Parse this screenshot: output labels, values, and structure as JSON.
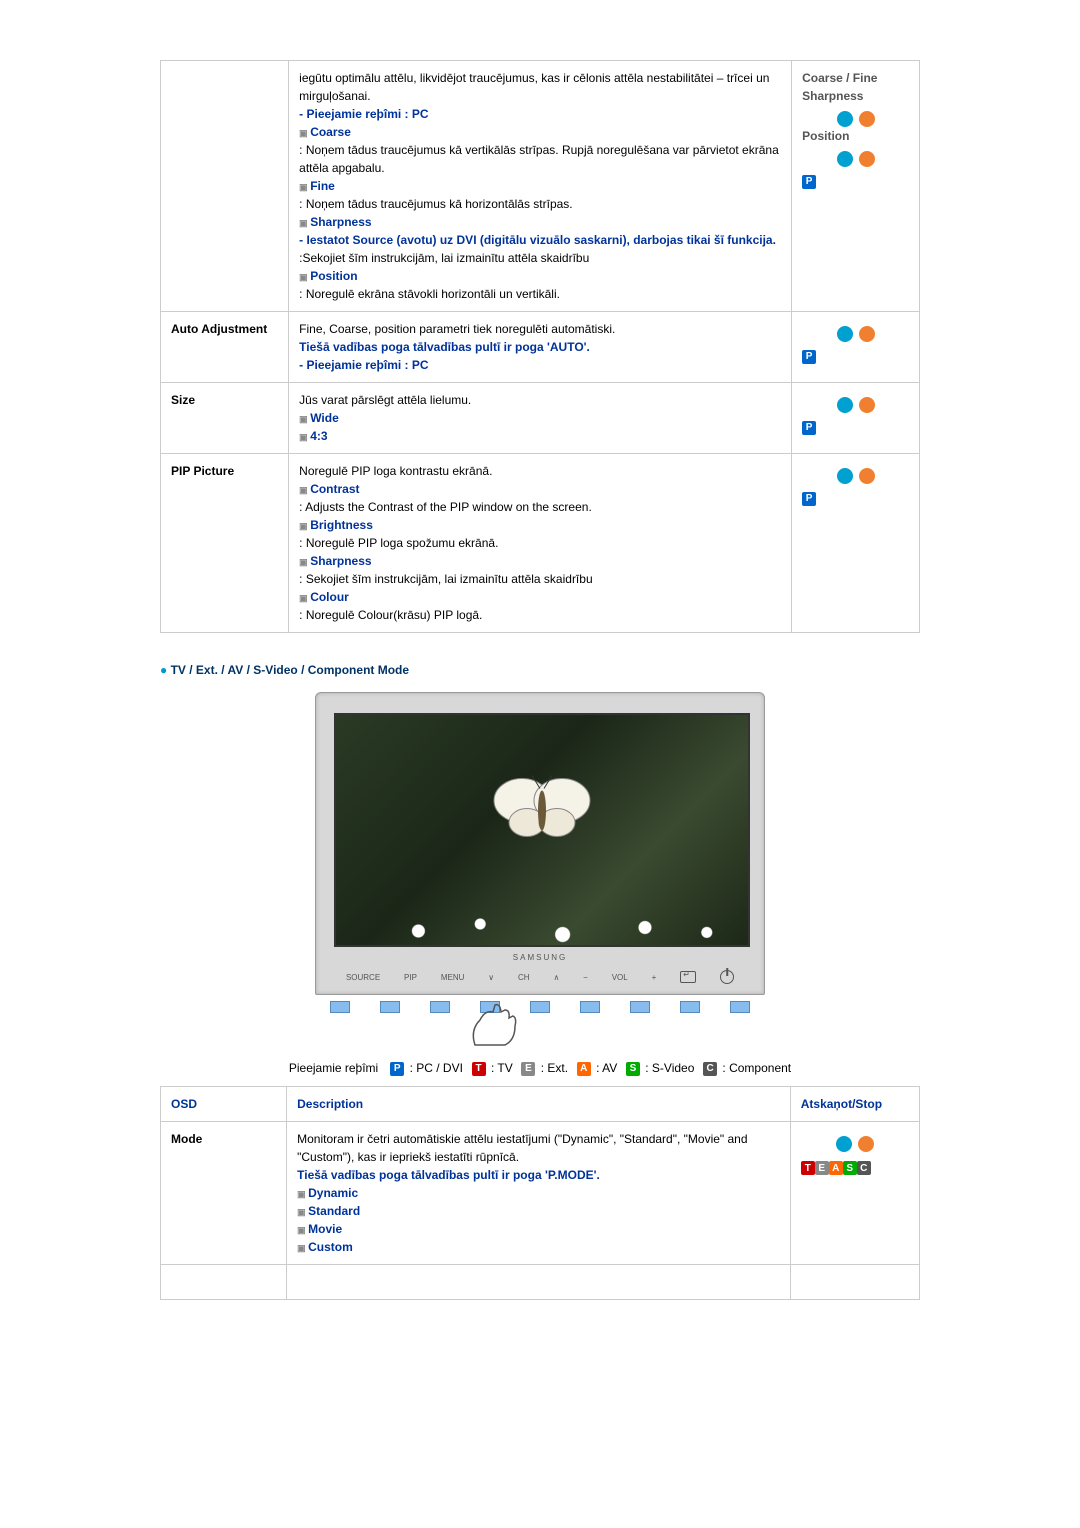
{
  "table1": {
    "row1": {
      "intro": "iegūtu optimālu attēlu, likvidējot traucējumus, kas ir cēlonis attēla nestabilitātei – trīcei un mirguļošanai.",
      "modes": "- Pieejamie reþîmi : PC",
      "coarse": "Coarse",
      "coarse_desc": ": Noņem tādus traucējumus kā vertikālās strīpas. Rupjā noregulēšana var pārvietot ekrāna attēla apgabalu.",
      "fine": "Fine",
      "fine_desc": ": Noņem tādus traucējumus kā horizontālās strīpas.",
      "sharpness": "Sharpness",
      "sharpness_note": "- Iestatot Source (avotu) uz DVI (digitālu vizuālo saskarni), darbojas tikai šī funkcija.",
      "sharpness_desc": ":Sekojiet šīm instrukcijām, lai izmainītu attēla skaidrību",
      "position": "Position",
      "position_desc": ": Noregulē ekrāna stāvokli horizontāli un vertikāli.",
      "right_label1": "Coarse / Fine",
      "right_label2": "Sharpness",
      "right_label3": "Position"
    },
    "row2": {
      "label": "Auto Adjustment",
      "text": "Fine, Coarse, position parametri tiek noregulēti automātiski.",
      "bold1": "Tiešā vadības poga tālvadības pultī ir poga 'AUTO'.",
      "bold2": "- Pieejamie reþîmi : PC"
    },
    "row3": {
      "label": "Size",
      "text": "Jūs varat pārslēgt attēla lielumu.",
      "wide": "Wide",
      "ratio": "4:3"
    },
    "row4": {
      "label": "PIP Picture",
      "intro": "Noregulē PIP loga kontrastu ekrānā.",
      "contrast": "Contrast",
      "contrast_desc": ": Adjusts the Contrast of the PIP window on the screen.",
      "brightness": "Brightness",
      "brightness_desc": ": Noregulē PIP loga spožumu ekrānā.",
      "sharpness": "Sharpness",
      "sharpness_desc": ": Sekojiet šīm instrukcijām, lai izmainītu attēla skaidrību",
      "colour": "Colour",
      "colour_desc": ": Noregulē Colour(krāsu) PIP logā."
    }
  },
  "section_heading": "TV / Ext. / AV / S-Video / Component Mode",
  "monitor": {
    "brand": "SAMSUNG",
    "buttons": {
      "source": "SOURCE",
      "pip": "PIP",
      "menu": "MENU",
      "ch_down": "∨",
      "ch": "CH",
      "ch_up": "∧",
      "vol_down": "−",
      "vol": "VOL",
      "vol_up": "+"
    }
  },
  "modes_line": {
    "prefix": "Pieejamie reþîmi",
    "p": "P",
    "p_label": ": PC / DVI",
    "t": "T",
    "t_label": ": TV",
    "e": "E",
    "e_label": ": Ext.",
    "a": "A",
    "a_label": ": AV",
    "s": "S",
    "s_label": ": S-Video",
    "c": "C",
    "c_label": ": Component"
  },
  "table2": {
    "header": {
      "osd": "OSD",
      "desc": "Description",
      "play": "Atskaņot/Stop"
    },
    "row_mode": {
      "label": "Mode",
      "text": "Monitoram ir četri automātiskie attēlu iestatījumi (\"Dynamic\", \"Standard\", \"Movie\" and \"Custom\"), kas ir iepriekš iestatīti rūpnīcā.",
      "bold": "Tiešā vadības poga tālvadības pultī ir poga 'P.MODE'.",
      "dynamic": "Dynamic",
      "standard": "Standard",
      "movie": "Movie",
      "custom": "Custom"
    }
  },
  "badges": {
    "P": "P",
    "T": "T",
    "E": "E",
    "A": "A",
    "S": "S",
    "C": "C"
  }
}
